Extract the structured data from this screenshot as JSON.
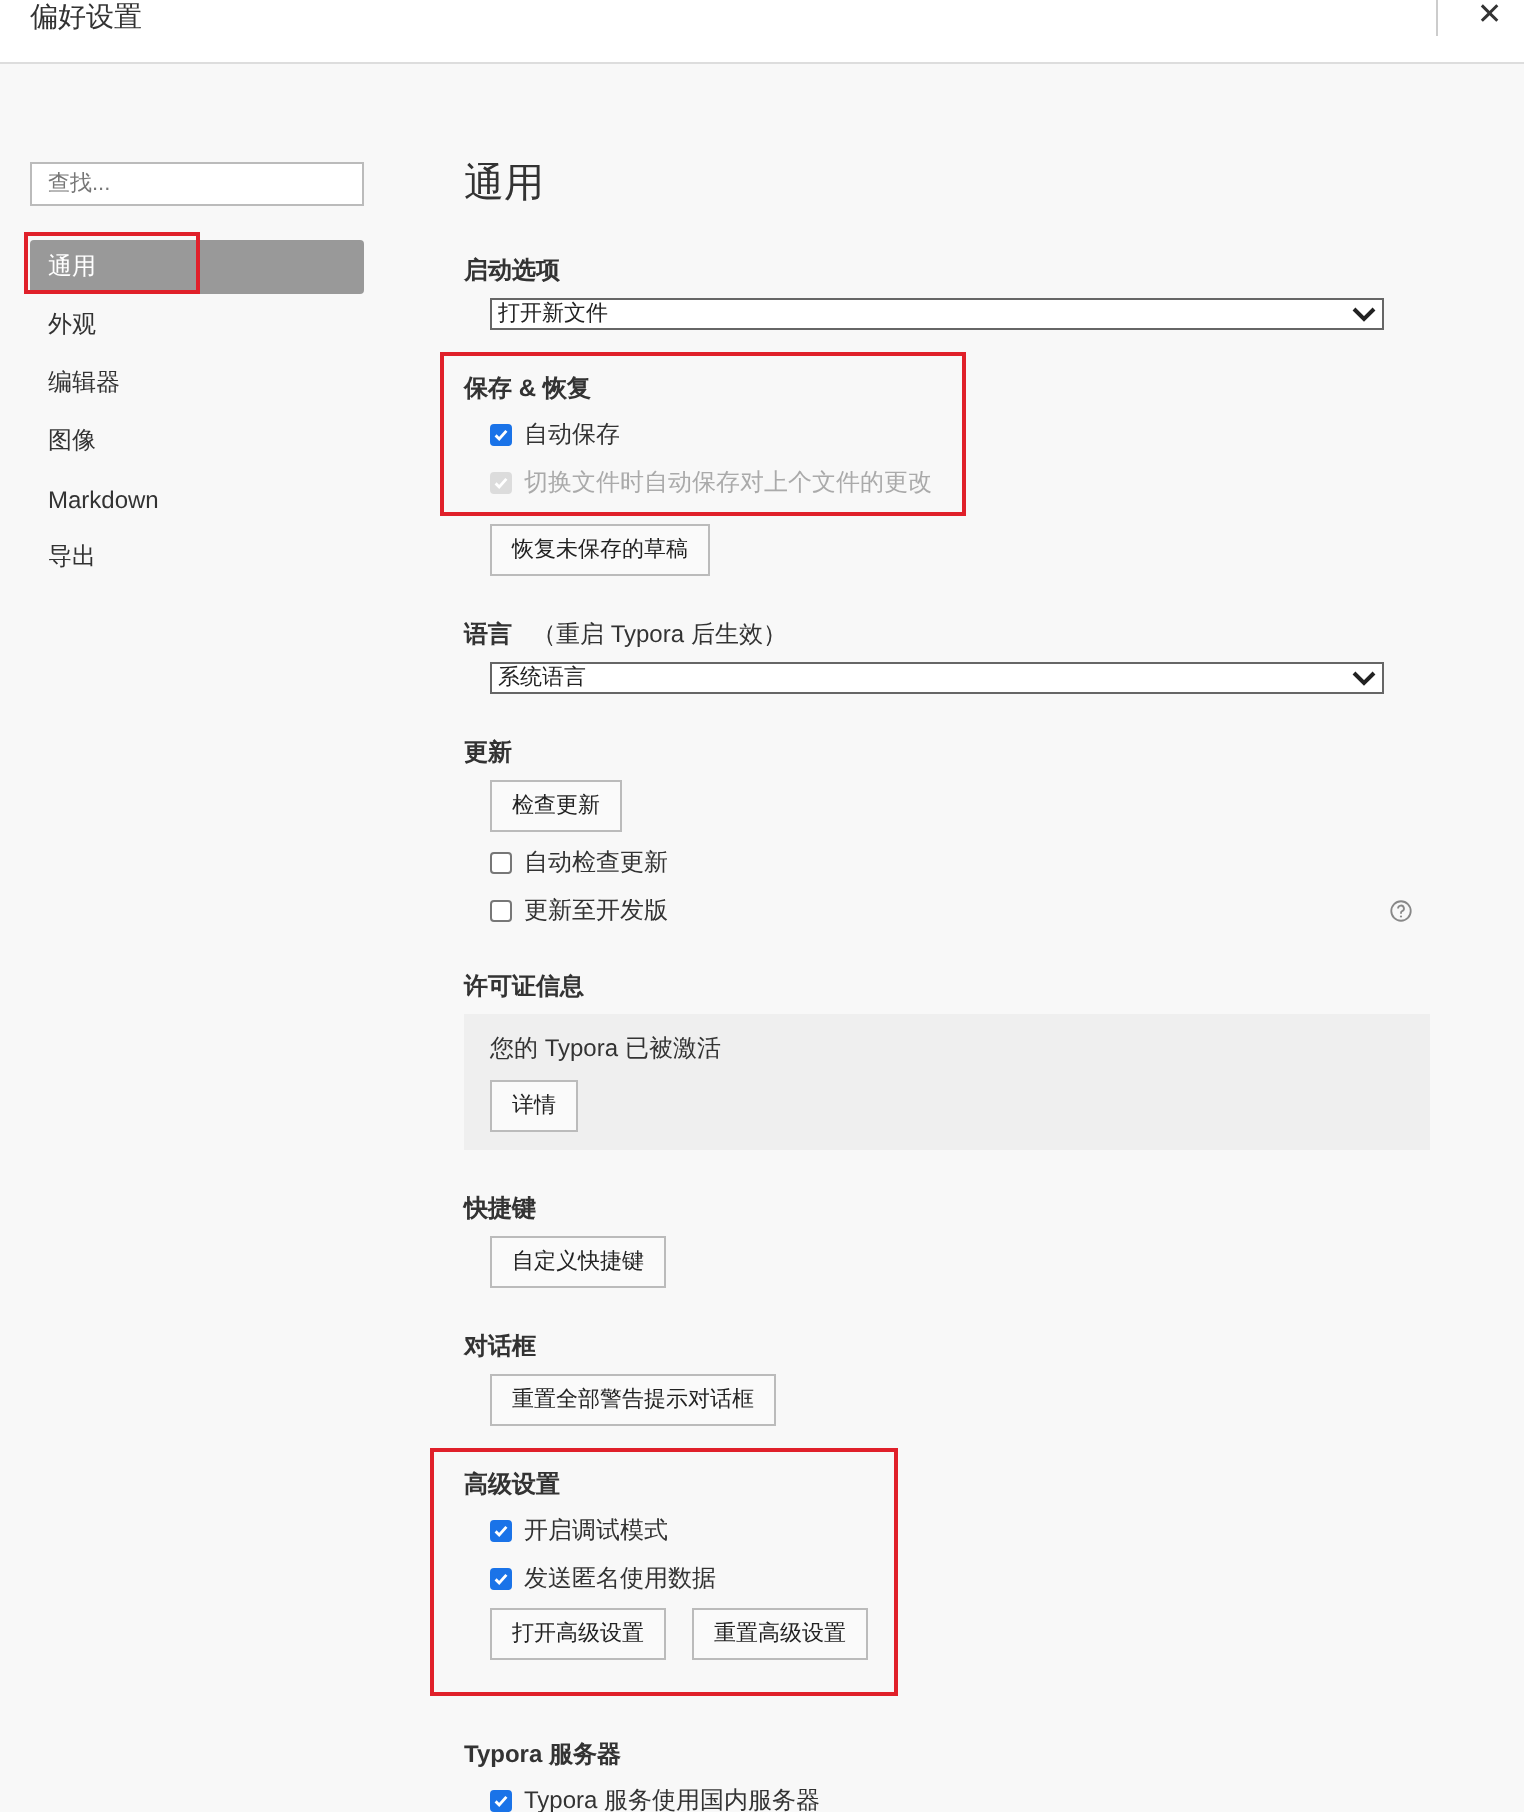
{
  "window": {
    "title": "偏好设置",
    "close": "✕"
  },
  "sidebar": {
    "search": {
      "placeholder": "查找..."
    },
    "items": [
      {
        "label": "通用",
        "selected": true,
        "framed": true
      },
      {
        "label": "外观",
        "selected": false,
        "framed": false
      },
      {
        "label": "编辑器",
        "selected": false,
        "framed": false
      },
      {
        "label": "图像",
        "selected": false,
        "framed": false
      },
      {
        "label": "Markdown",
        "selected": false,
        "framed": false
      },
      {
        "label": "导出",
        "selected": false,
        "framed": false
      }
    ]
  },
  "page_title": "通用",
  "sections": [
    {
      "heading": "启动选项",
      "items": [
        {
          "kind": "select",
          "value": "打开新文件"
        }
      ]
    },
    {
      "heading": "保存 & 恢复",
      "items": [
        {
          "kind": "checkbox",
          "label": "自动保存",
          "checked": true,
          "disabled": false,
          "framed": true
        },
        {
          "kind": "checkbox",
          "label": "切换文件时自动保存对上个文件的更改",
          "checked": true,
          "disabled": true,
          "framed": true
        },
        {
          "kind": "buttons",
          "buttons": [
            "恢复未保存的草稿"
          ],
          "framed": false
        }
      ]
    },
    {
      "heading": "语言",
      "note": "（重启 Typora 后生效）",
      "items": [
        {
          "kind": "select",
          "value": "系统语言"
        }
      ]
    },
    {
      "heading": "更新",
      "items": [
        {
          "kind": "buttons",
          "buttons": [
            "检查更新"
          ]
        },
        {
          "kind": "checkbox",
          "label": "自动检查更新",
          "checked": false,
          "disabled": false
        },
        {
          "kind": "checkbox",
          "label": "更新至开发版",
          "checked": false,
          "disabled": false,
          "help": true
        }
      ]
    },
    {
      "heading": "许可证信息",
      "items": [
        {
          "kind": "panel",
          "text": "您的 Typora 已被激活",
          "buttons": [
            "详情"
          ]
        }
      ]
    },
    {
      "heading": "快捷键",
      "items": [
        {
          "kind": "buttons",
          "buttons": [
            "自定义快捷键"
          ]
        }
      ]
    },
    {
      "heading": "对话框",
      "items": [
        {
          "kind": "buttons",
          "buttons": [
            "重置全部警告提示对话框"
          ]
        }
      ]
    },
    {
      "heading": "高级设置",
      "items": [
        {
          "kind": "checkbox",
          "label": "开启调试模式",
          "checked": true,
          "disabled": false,
          "framed": true
        },
        {
          "kind": "checkbox",
          "label": "发送匿名使用数据",
          "checked": true,
          "disabled": false,
          "framed": true
        },
        {
          "kind": "buttons",
          "buttons": [
            "打开高级设置",
            "重置高级设置"
          ],
          "framed": true
        }
      ]
    },
    {
      "heading": "Typora 服务器",
      "items": [
        {
          "kind": "checkbox",
          "label": "Typora 服务使用国内服务器",
          "checked": true,
          "disabled": false
        }
      ]
    }
  ]
}
